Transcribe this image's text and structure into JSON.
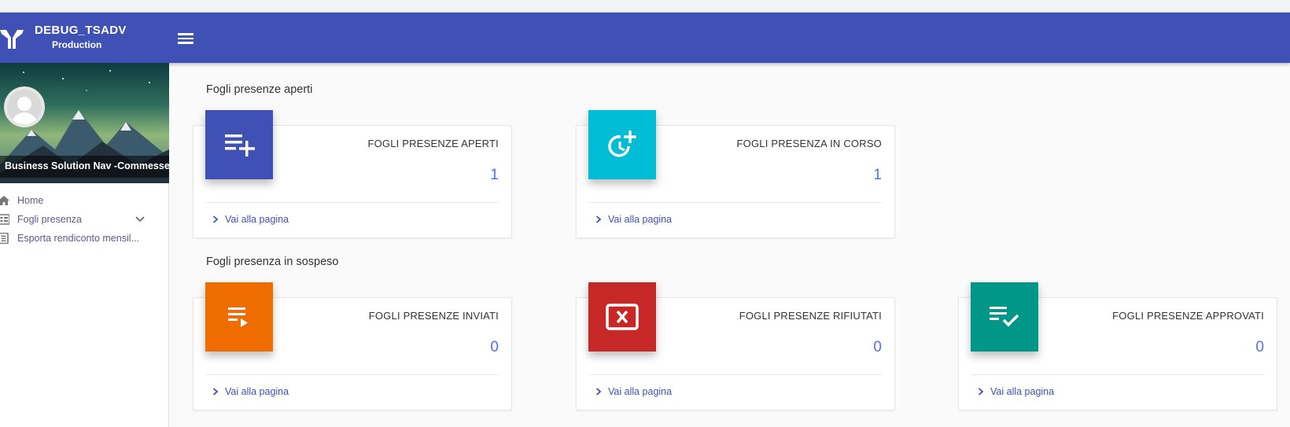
{
  "app": {
    "title": "DEBUG_TSADV",
    "environment": "Production"
  },
  "sidebar": {
    "company": "Business Solution Nav -Commesse",
    "items": [
      {
        "label": "Home",
        "icon": "home-icon"
      },
      {
        "label": "Fogli presenza",
        "icon": "list-icon"
      },
      {
        "label": "Esporta rendiconto mensil...",
        "icon": "document-icon"
      }
    ]
  },
  "sections": [
    {
      "title": "Fogli presenze aperti",
      "cards": [
        {
          "label": "FOGLI PRESENZE APERTI",
          "count": "1",
          "link": "Vai alla pagina",
          "color": "#3f51b5",
          "icon": "playlist-add-icon"
        },
        {
          "label": "FOGLI PRESENZA IN CORSO",
          "count": "1",
          "link": "Vai alla pagina",
          "color": "#00bcd4",
          "icon": "clock-plus-icon"
        }
      ]
    },
    {
      "title": "Fogli presenza in sospeso",
      "cards": [
        {
          "label": "FOGLI PRESENZE INVIATI",
          "count": "0",
          "link": "Vai alla pagina",
          "color": "#ef6c00",
          "icon": "playlist-play-icon"
        },
        {
          "label": "FOGLI PRESENZE RIFIUTATI",
          "count": "0",
          "link": "Vai alla pagina",
          "color": "#c62828",
          "icon": "close-box-icon"
        },
        {
          "label": "FOGLI PRESENZE APPROVATI",
          "count": "0",
          "link": "Vai alla pagina",
          "color": "#009688",
          "icon": "playlist-check-icon"
        }
      ]
    }
  ]
}
